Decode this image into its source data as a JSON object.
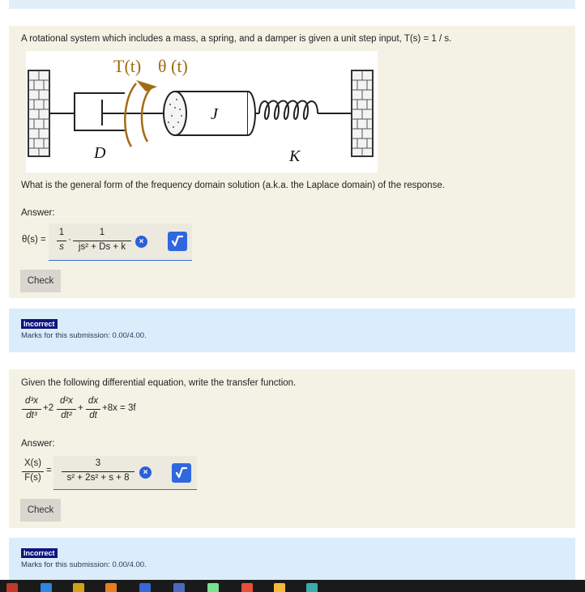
{
  "question1": {
    "prompt": "A rotational system which includes a mass, a spring, and a damper is given a unit step input, T(s) = 1 / s.",
    "figure": {
      "torque_label": "T(t)",
      "theta_label": "θ (t)",
      "inertia_label": "J",
      "damper_label": "D",
      "spring_label": "K"
    },
    "question": "What is the general form of the frequency domain solution (a.k.a. the Laplace domain) of the response.",
    "answer_label": "Answer:",
    "lhs": "θ(s) =",
    "term1_num": "1",
    "term1_den": "s",
    "dot": "·",
    "term2_num": "1",
    "term2_den": "js² + Ds + k",
    "clear_icon": "×",
    "check_label": "Check",
    "feedback": {
      "badge": "Incorrect",
      "marks": "Marks for this submission: 0.00/4.00."
    }
  },
  "question2": {
    "prompt": "Given the following differential equation, write the transfer function.",
    "eq": {
      "d3_num": "d³x",
      "d3_den": "dt³",
      "plus2": "+2",
      "d2_num": "d²x",
      "d2_den": "dt²",
      "plus": "+",
      "d1_num": "dx",
      "d1_den": "dt",
      "rest": "+8x = 3f"
    },
    "answer_label": "Answer:",
    "lhs_num": "X(s)",
    "lhs_den": "F(s)",
    "equals": "=",
    "rhs_num": "3",
    "rhs_den": "s² + 2s² + s + 8",
    "clear_icon": "×",
    "check_label": "Check",
    "feedback": {
      "badge": "Incorrect",
      "marks": "Marks for this submission: 0.00/4.00."
    }
  },
  "colors": {
    "question_bg": "#f4f2e5",
    "feedback_bg": "#dbedfa",
    "accent_blue": "#2f67e0",
    "incorrect_badge": "#10147e",
    "label_gold": "#a26c12"
  },
  "taskbar": {
    "icons": [
      "windows-icon",
      "file-explorer-icon",
      "mail-icon",
      "app-icon",
      "browser-icon",
      "app-icon",
      "store-icon",
      "office-icon",
      "chrome-icon",
      "app-icon"
    ]
  }
}
